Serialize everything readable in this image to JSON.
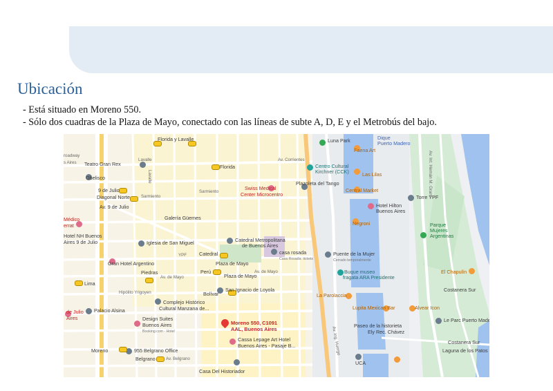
{
  "page": {
    "title": "Ubicación",
    "bullets": [
      "- Está situado en Moreno 550.",
      "- Sólo dos cuadras de la Plaza de Mayo, conectado con las líneas de subte A, D, E y el Metrobús del bajo."
    ]
  },
  "colors": {
    "title": "#2a5f97",
    "banner": "#e3ecf5",
    "water": "#9fc2ee",
    "park": "#cde9cf",
    "highlight": "#fdf3c4"
  },
  "map": {
    "labels": [
      {
        "text": "Lavalle",
        "cls": "street"
      },
      {
        "text": "Florida y Lavalle",
        "cls": ""
      },
      {
        "text": "Teatro Gran Rex",
        "cls": ""
      },
      {
        "text": "roadway",
        "cls": "street"
      },
      {
        "text": "s Aires",
        "cls": "street"
      },
      {
        "text": "Obelisco",
        "cls": ""
      },
      {
        "text": "Florida",
        "cls": ""
      },
      {
        "text": "Av. Corrientes",
        "cls": "street"
      },
      {
        "text": "Centro Cultural",
        "cls": "teal"
      },
      {
        "text": "Kirchner (CCK)",
        "cls": "teal"
      },
      {
        "text": "Luna Park",
        "cls": ""
      },
      {
        "text": "Dique",
        "cls": "blue"
      },
      {
        "text": "Puerto Madero",
        "cls": "blue"
      },
      {
        "text": "Faena Art",
        "cls": "orange"
      },
      {
        "text": "Las Lilas",
        "cls": "orange"
      },
      {
        "text": "9 de Julio",
        "cls": ""
      },
      {
        "text": "Diagonal Norte",
        "cls": ""
      },
      {
        "text": "Sarmiento",
        "cls": "street"
      },
      {
        "text": "Sarmiento",
        "cls": "street"
      },
      {
        "text": "Swiss Medical",
        "cls": "red"
      },
      {
        "text": "Center Microcentro",
        "cls": "red"
      },
      {
        "text": "Plazoleta del Tango",
        "cls": ""
      },
      {
        "text": "Central Market",
        "cls": "orange"
      },
      {
        "text": "Torre YPF",
        "cls": ""
      },
      {
        "text": "Av. 9 de Julio",
        "cls": ""
      },
      {
        "text": "Hotel Hilton",
        "cls": "pink"
      },
      {
        "text": "Buenos Aires",
        "cls": "pink"
      },
      {
        "text": "Médico",
        "cls": "red"
      },
      {
        "text": "errat",
        "cls": "red"
      },
      {
        "text": "Galería Güemes",
        "cls": ""
      },
      {
        "text": "Negroni",
        "cls": "orange"
      },
      {
        "text": "Parque",
        "cls": "green"
      },
      {
        "text": "Mujeres",
        "cls": "green"
      },
      {
        "text": "Argentinas",
        "cls": "green"
      },
      {
        "text": "Hotel NH Buenos",
        "cls": "pink"
      },
      {
        "text": "Aires 9 de Julio",
        "cls": "pink"
      },
      {
        "text": "Iglesia de San Miguel",
        "cls": ""
      },
      {
        "text": "Catedral Metropolitana",
        "cls": ""
      },
      {
        "text": "de Buenos Aires",
        "cls": ""
      },
      {
        "text": "YPF",
        "cls": "street"
      },
      {
        "text": "Catedral",
        "cls": ""
      },
      {
        "text": "casa rosada",
        "cls": ""
      },
      {
        "text": "Casa Rosada: tickets",
        "cls": "small"
      },
      {
        "text": "Puente de la Mujer",
        "cls": ""
      },
      {
        "text": "Cerrado temporalmente",
        "cls": "small"
      },
      {
        "text": "Gran Hotel Argentino",
        "cls": "pink"
      },
      {
        "text": "Plaza de Mayo",
        "cls": ""
      },
      {
        "text": "Plaza de Mayo",
        "cls": ""
      },
      {
        "text": "Piedras",
        "cls": ""
      },
      {
        "text": "Av. de Mayo",
        "cls": "street"
      },
      {
        "text": "Perú",
        "cls": ""
      },
      {
        "text": "Buque museo",
        "cls": "teal"
      },
      {
        "text": "fragata ARA Presidente",
        "cls": "teal"
      },
      {
        "text": "El Chapulín",
        "cls": "orange"
      },
      {
        "text": "Lima",
        "cls": ""
      },
      {
        "text": "Hipólito Yrigoyen",
        "cls": "street"
      },
      {
        "text": "Costanera Sur",
        "cls": ""
      },
      {
        "text": "Bolívar",
        "cls": ""
      },
      {
        "text": "San Ignacio de Loyola",
        "cls": ""
      },
      {
        "text": "La Parolaccia",
        "cls": "orange"
      },
      {
        "text": "Complejo Histórico",
        "cls": ""
      },
      {
        "text": "Cultural Manzana de...",
        "cls": ""
      },
      {
        "text": "Lupita Mexican Bar",
        "cls": "orange"
      },
      {
        "text": "Alvear Icon",
        "cls": "orange"
      },
      {
        "text": "de Julio",
        "cls": "red"
      },
      {
        "text": "Palacio Alsina",
        "cls": ""
      },
      {
        "text": "Aires",
        "cls": "red"
      },
      {
        "text": "Design Suites",
        "cls": ""
      },
      {
        "text": "Buenos Aires",
        "cls": ""
      },
      {
        "text": "Booking.com - Hotel",
        "cls": "small"
      },
      {
        "text": "Moreno 550, C1091",
        "cls": "pin"
      },
      {
        "text": "AAL, Buenos Aires",
        "cls": "pin"
      },
      {
        "text": "Paseo de la historieta",
        "cls": ""
      },
      {
        "text": "Ely Rec. Chávez",
        "cls": ""
      },
      {
        "text": "Le Parc Puerto Madero",
        "cls": ""
      },
      {
        "text": "Cassa Lepage Art Hotel",
        "cls": "pink"
      },
      {
        "text": "Buenos Aires - Pasaje B...",
        "cls": "pink"
      },
      {
        "text": "Moreno",
        "cls": ""
      },
      {
        "text": "955 Belgrano Office",
        "cls": ""
      },
      {
        "text": "Costanera Sur",
        "cls": ""
      },
      {
        "text": "Laguna de los Patos",
        "cls": ""
      },
      {
        "text": "Belgrano",
        "cls": ""
      },
      {
        "text": "Av. Belgrano",
        "cls": "street"
      },
      {
        "text": "UCA",
        "cls": ""
      },
      {
        "text": "Casa Del Historiador",
        "cls": ""
      },
      {
        "text": "Lavalle",
        "cls": "street"
      },
      {
        "text": "Av. Ing. Huergo",
        "cls": "street"
      },
      {
        "text": "Av. de Mayo",
        "cls": "street"
      },
      {
        "text": "Av. Int. Hernán M. Grant",
        "cls": "street"
      }
    ]
  }
}
